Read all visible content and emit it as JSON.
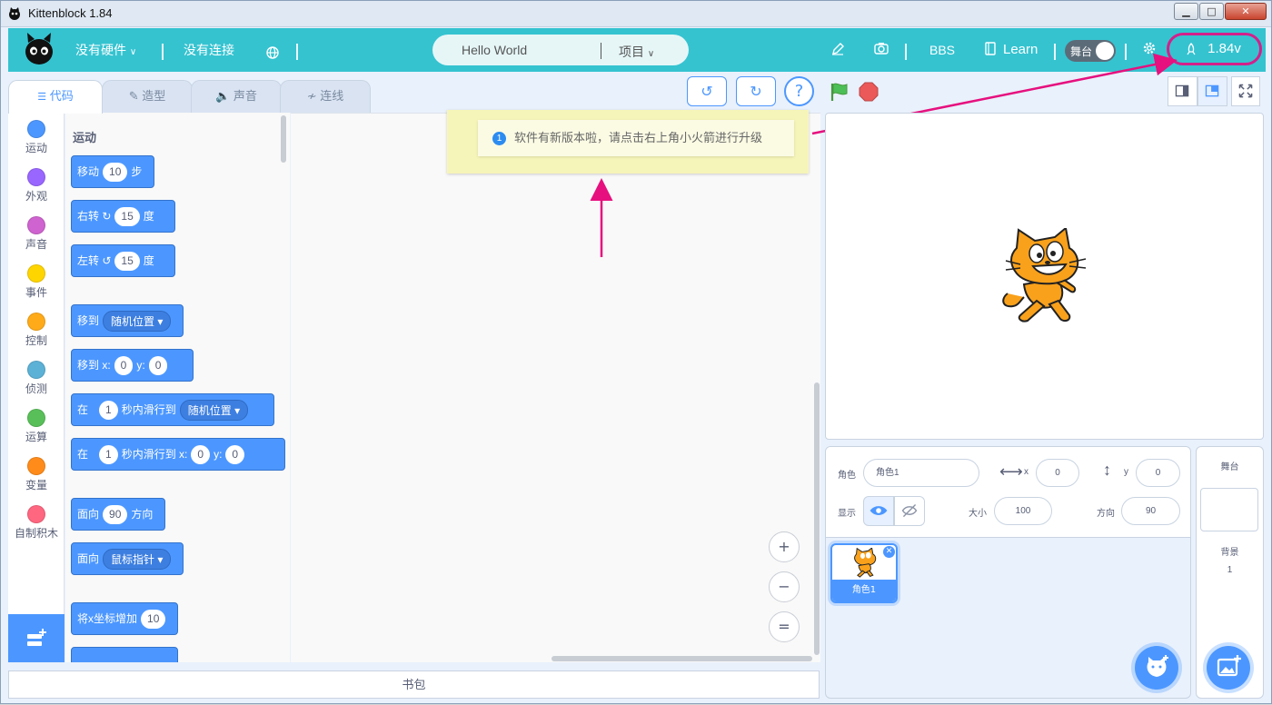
{
  "window": {
    "title": "Kittenblock 1.84",
    "minimize": "▁",
    "maximize": "□",
    "close": "✕"
  },
  "menubar": {
    "hardware": "没有硬件",
    "connection": "没有连接",
    "project_name": "Hello World",
    "project_menu": "项目",
    "bbs": "BBS",
    "learn": "Learn",
    "stage_toggle": "舞台",
    "version": "1.84v",
    "icons": [
      "cat-logo-icon",
      "chevron-down-icon",
      "globe-icon",
      "pencil-icon",
      "camera-icon",
      "book-icon",
      "gear-icon",
      "rocket-icon"
    ]
  },
  "tabs": [
    {
      "label": "代码",
      "icon": "code-icon",
      "active": true
    },
    {
      "label": "造型",
      "icon": "brush-icon",
      "active": false
    },
    {
      "label": "声音",
      "icon": "speaker-icon",
      "active": false
    },
    {
      "label": "连线",
      "icon": "wire-icon",
      "active": false
    }
  ],
  "categories": [
    {
      "label": "运动",
      "color": "#4c97ff"
    },
    {
      "label": "外观",
      "color": "#9966ff"
    },
    {
      "label": "声音",
      "color": "#cf63cf"
    },
    {
      "label": "事件",
      "color": "#ffd500"
    },
    {
      "label": "控制",
      "color": "#ffab19"
    },
    {
      "label": "侦测",
      "color": "#5cb1d6"
    },
    {
      "label": "运算",
      "color": "#59c059"
    },
    {
      "label": "变量",
      "color": "#ff8c1a"
    },
    {
      "label": "自制积木",
      "color": "#ff6680"
    }
  ],
  "palette": {
    "title": "运动",
    "blocks": {
      "move": {
        "a": "移动",
        "v": "10",
        "b": "步"
      },
      "turn_right": {
        "a": "右转",
        "v": "15",
        "b": "度"
      },
      "turn_left": {
        "a": "左转",
        "v": "15",
        "b": "度"
      },
      "goto": {
        "a": "移到",
        "dd": "随机位置"
      },
      "goto_xy": {
        "a": "移到 x:",
        "x": "0",
        "yl": "y:",
        "y": "0"
      },
      "glide": {
        "a": "在",
        "v": "1",
        "b": "秒内滑行到",
        "dd": "随机位置"
      },
      "glide_xy": {
        "a": "在",
        "v": "1",
        "b": "秒内滑行到 x:",
        "x": "0",
        "yl": "y:",
        "y": "0"
      },
      "point": {
        "a": "面向",
        "v": "90",
        "b": "方向"
      },
      "point_towards": {
        "a": "面向",
        "dd": "鼠标指针"
      },
      "change_x": {
        "a": "将x坐标增加",
        "v": "10"
      }
    }
  },
  "notice": {
    "text": "软件有新版本啦，请点击右上角小火箭进行升级",
    "icon": "1"
  },
  "zoom": {
    "in": "+",
    "out": "−",
    "reset": "="
  },
  "sprite_info": {
    "sprite_label": "角色",
    "sprite_name": "角色1",
    "x_label": "x",
    "x": "0",
    "y_label": "y",
    "y": "0",
    "show_label": "显示",
    "size_label": "大小",
    "size": "100",
    "direction_label": "方向",
    "direction": "90"
  },
  "sprites": [
    {
      "name": "角色1"
    }
  ],
  "stage_pane": {
    "title": "舞台",
    "backdrop_label": "背景",
    "backdrop_count": "1"
  },
  "backpack": "书包"
}
